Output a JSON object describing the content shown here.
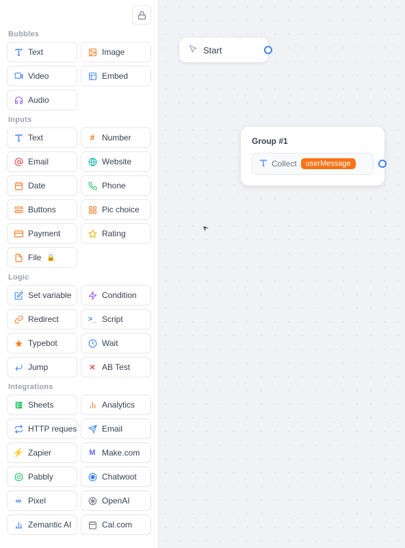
{
  "sidebar": {
    "sections": [
      {
        "label": "Bubbles",
        "items": [
          {
            "id": "text-bubble",
            "icon": "T",
            "icon_class": "ic-blue",
            "label": "Text"
          },
          {
            "id": "image-bubble",
            "icon": "🖼",
            "icon_class": "ic-orange",
            "label": "Image"
          },
          {
            "id": "video-bubble",
            "icon": "▶",
            "icon_class": "ic-blue",
            "label": "Video"
          },
          {
            "id": "embed-bubble",
            "icon": "⊞",
            "icon_class": "ic-blue",
            "label": "Embed"
          },
          {
            "id": "audio-bubble",
            "icon": "🎧",
            "icon_class": "ic-purple",
            "label": "Audio"
          }
        ]
      },
      {
        "label": "Inputs",
        "items": [
          {
            "id": "text-input",
            "icon": "T",
            "icon_class": "ic-blue",
            "label": "Text"
          },
          {
            "id": "number-input",
            "icon": "#",
            "icon_class": "ic-orange",
            "label": "Number"
          },
          {
            "id": "email-input",
            "icon": "✉",
            "icon_class": "ic-red",
            "label": "Email"
          },
          {
            "id": "website-input",
            "icon": "🌐",
            "icon_class": "ic-teal",
            "label": "Website"
          },
          {
            "id": "date-input",
            "icon": "📅",
            "icon_class": "ic-orange",
            "label": "Date"
          },
          {
            "id": "phone-input",
            "icon": "📞",
            "icon_class": "ic-green",
            "label": "Phone"
          },
          {
            "id": "buttons-input",
            "icon": "☰",
            "icon_class": "ic-orange",
            "label": "Buttons"
          },
          {
            "id": "pic-choice-input",
            "icon": "⊞",
            "icon_class": "ic-orange",
            "label": "Pic choice"
          },
          {
            "id": "payment-input",
            "icon": "💳",
            "icon_class": "ic-orange",
            "label": "Payment"
          },
          {
            "id": "rating-input",
            "icon": "☆",
            "icon_class": "ic-yellow",
            "label": "Rating"
          },
          {
            "id": "file-input",
            "icon": "📄",
            "icon_class": "ic-orange",
            "label": "File",
            "locked": true
          }
        ]
      },
      {
        "label": "Logic",
        "items": [
          {
            "id": "set-variable",
            "icon": "✏",
            "icon_class": "ic-blue",
            "label": "Set variable"
          },
          {
            "id": "condition",
            "icon": "⚡",
            "icon_class": "ic-purple",
            "label": "Condition"
          },
          {
            "id": "redirect",
            "icon": "↗",
            "icon_class": "ic-orange",
            "label": "Redirect"
          },
          {
            "id": "script",
            "icon": "›_",
            "icon_class": "ic-blue",
            "label": "Script"
          },
          {
            "id": "typebot",
            "icon": "✦",
            "icon_class": "ic-orange",
            "label": "Typebot"
          },
          {
            "id": "wait",
            "icon": "⏱",
            "icon_class": "ic-blue",
            "label": "Wait"
          },
          {
            "id": "jump",
            "icon": "⇥",
            "icon_class": "ic-blue",
            "label": "Jump"
          },
          {
            "id": "ab-test",
            "icon": "✕",
            "icon_class": "ic-red",
            "label": "AB Test"
          }
        ]
      },
      {
        "label": "Integrations",
        "items": [
          {
            "id": "sheets",
            "icon": "📊",
            "icon_class": "ic-green",
            "label": "Sheets"
          },
          {
            "id": "analytics",
            "icon": "📈",
            "icon_class": "ic-orange",
            "label": "Analytics"
          },
          {
            "id": "http-request",
            "icon": "⟳",
            "icon_class": "ic-blue",
            "label": "HTTP request"
          },
          {
            "id": "email-integration",
            "icon": "✈",
            "icon_class": "ic-blue",
            "label": "Email"
          },
          {
            "id": "zapier",
            "icon": "⚡",
            "icon_class": "ic-orange",
            "label": "Zapier"
          },
          {
            "id": "make",
            "icon": "M",
            "icon_class": "ic-purple",
            "label": "Make.com"
          },
          {
            "id": "pabbly",
            "icon": "◎",
            "icon_class": "ic-green",
            "label": "Pabbly"
          },
          {
            "id": "chatwoot",
            "icon": "◉",
            "icon_class": "ic-blue",
            "label": "Chatwoot"
          },
          {
            "id": "pixel",
            "icon": "∞",
            "icon_class": "ic-blue",
            "label": "Pixel"
          },
          {
            "id": "openai",
            "icon": "◈",
            "icon_class": "ic-gray",
            "label": "OpenAI"
          },
          {
            "id": "zemantic-ai",
            "icon": "📊",
            "icon_class": "ic-blue",
            "label": "Zemantic AI"
          },
          {
            "id": "cal-com",
            "icon": "⊞",
            "icon_class": "ic-gray",
            "label": "Cal.com"
          }
        ]
      }
    ]
  },
  "canvas": {
    "start_node": {
      "label": "Start"
    },
    "group_node": {
      "title": "Group #1",
      "block_label": "Collect",
      "block_highlight": "userMessage"
    }
  }
}
